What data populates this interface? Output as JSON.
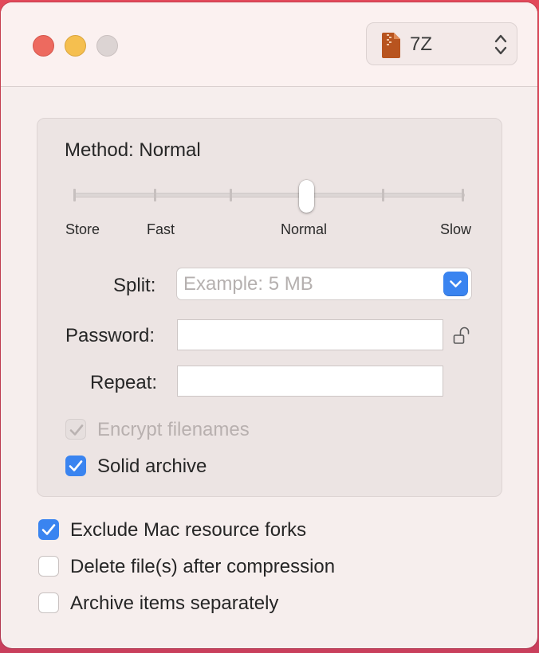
{
  "format": {
    "label": "7Z",
    "icon": "archive-file-icon"
  },
  "compression": {
    "method_label": "Method: Normal",
    "level_value": 3,
    "level_max": 5,
    "levels": [
      "Store",
      "Fast",
      "Normal",
      "Slow"
    ]
  },
  "split": {
    "label": "Split:",
    "placeholder": "Example: 5 MB",
    "value": ""
  },
  "password": {
    "label": "Password:",
    "value": "",
    "lock_icon": "unlocked-icon"
  },
  "repeat": {
    "label": "Repeat:",
    "value": ""
  },
  "options_inner": [
    {
      "label": "Encrypt filenames",
      "checked": true,
      "enabled": false
    },
    {
      "label": "Solid archive",
      "checked": true,
      "enabled": true
    }
  ],
  "options_outer": [
    {
      "label": "Exclude Mac resource forks",
      "checked": true
    },
    {
      "label": "Delete file(s) after compression",
      "checked": false
    },
    {
      "label": "Archive items separately",
      "checked": false
    }
  ],
  "colors": {
    "accent": "#3a84f0",
    "close": "#ed6a5f",
    "minimize": "#f5bf4f"
  }
}
